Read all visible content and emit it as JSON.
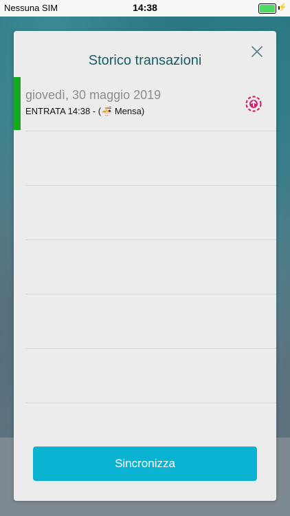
{
  "status_bar": {
    "carrier": "Nessuna SIM",
    "time": "14:38",
    "battery_level": 1.0,
    "battery_color": "#4cd964"
  },
  "modal": {
    "title": "Storico transazioni",
    "close_icon": "close-icon",
    "transactions": [
      {
        "date": "giovedì, 30 maggio 2019",
        "detail": "ENTRATA 14:38 - (🍜 Mensa)",
        "status_icon": "upload-pending-icon",
        "accent_color": "#14a91e"
      }
    ],
    "sync_button_label": "Sincronizza"
  },
  "colors": {
    "title": "#175e63",
    "accent": "#0ab3d1",
    "status_icon": "#d1236b"
  }
}
